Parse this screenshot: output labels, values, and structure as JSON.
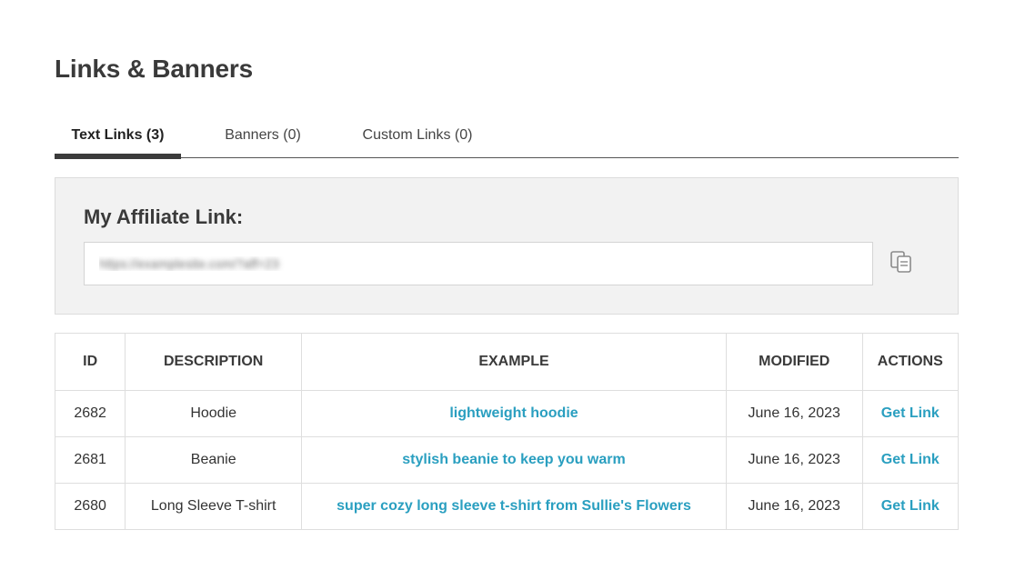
{
  "page": {
    "title": "Links & Banners"
  },
  "tabs": [
    {
      "label": "Text Links (3)",
      "active": true
    },
    {
      "label": "Banners (0)",
      "active": false
    },
    {
      "label": "Custom Links (0)",
      "active": false
    }
  ],
  "affiliate": {
    "label": "My Affiliate Link:",
    "value": "https://examplesite.com/?aff=23",
    "value_blurred": true,
    "copy_icon": "copy-icon"
  },
  "table": {
    "headers": {
      "id": "ID",
      "description": "DESCRIPTION",
      "example": "EXAMPLE",
      "modified": "MODIFIED",
      "actions": "ACTIONS"
    },
    "rows": [
      {
        "id": "2682",
        "description": "Hoodie",
        "example": "lightweight hoodie",
        "modified": "June 16, 2023",
        "action": "Get Link"
      },
      {
        "id": "2681",
        "description": "Beanie",
        "example": "stylish beanie to keep you warm",
        "modified": "June 16, 2023",
        "action": "Get Link"
      },
      {
        "id": "2680",
        "description": "Long Sleeve T-shirt",
        "example": "super cozy long sleeve t-shirt from Sullie's Flowers",
        "modified": "June 16, 2023",
        "action": "Get Link"
      }
    ]
  },
  "colors": {
    "link": "#2a9fc0",
    "tab_indicator": "#3b3b3b",
    "box_background": "#f2f2f2"
  }
}
